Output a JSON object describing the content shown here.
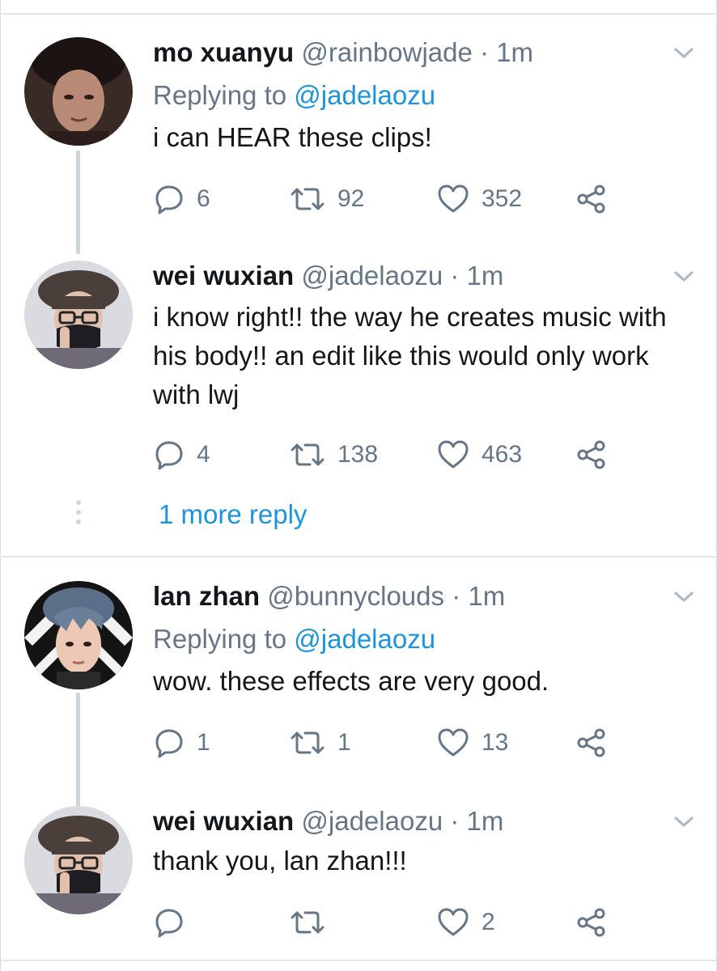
{
  "tweets": [
    {
      "name": "mo xuanyu",
      "handle": "@rainbowjade",
      "separator": "·",
      "time": "1m",
      "replying_prefix": "Replying to",
      "replying_to": "@jadelaozu",
      "text": "i can HEAR these clips!",
      "replies": "6",
      "retweets": "92",
      "likes": "352"
    },
    {
      "name": "wei wuxian",
      "handle": "@jadelaozu",
      "separator": "·",
      "time": "1m",
      "text": "i know right!! the way he creates music with his body!! an edit like this would only work with lwj",
      "replies": "4",
      "retweets": "138",
      "likes": "463"
    },
    {
      "name": "lan zhan",
      "handle": "@bunnyclouds",
      "separator": "·",
      "time": "1m",
      "replying_prefix": "Replying to",
      "replying_to": "@jadelaozu",
      "text": "wow. these effects are very good.",
      "replies": "1",
      "retweets": "1",
      "likes": "13"
    },
    {
      "name": "wei wuxian",
      "handle": "@jadelaozu",
      "separator": "·",
      "time": "1m",
      "text": "thank you, lan zhan!!!",
      "replies": "",
      "retweets": "",
      "likes": "2"
    }
  ],
  "more_replies_label": "1 more reply",
  "icons": {
    "reply": "reply-icon",
    "retweet": "retweet-icon",
    "like": "heart-icon",
    "share": "share-icon",
    "menu": "chevron-down-icon"
  },
  "colors": {
    "text": "#14171a",
    "secondary": "#657786",
    "link": "#1b95e0",
    "divider": "#e1e8ed",
    "thread_line": "#ccd6dd"
  }
}
